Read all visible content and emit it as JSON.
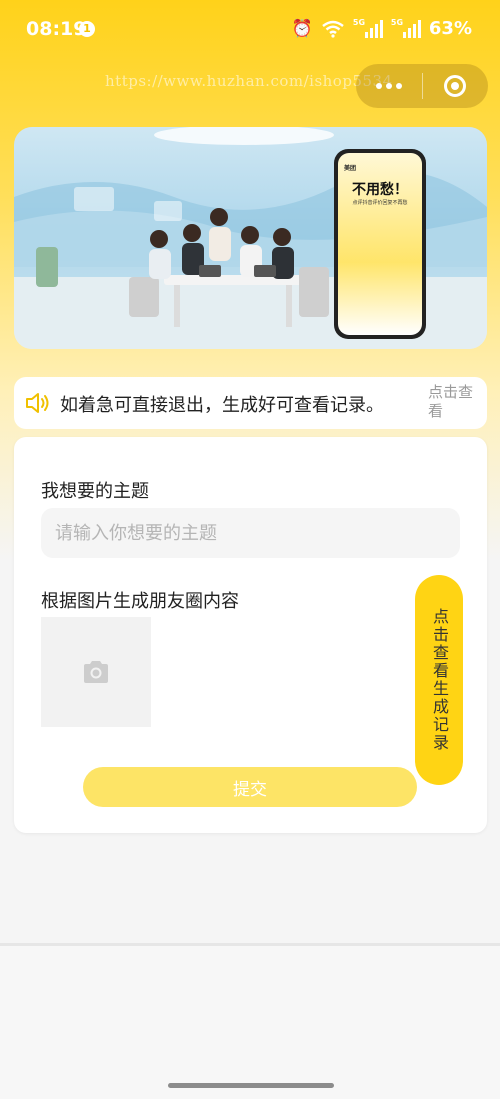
{
  "status_bar": {
    "time": "08:19",
    "notification_count": "1",
    "battery": "63%",
    "network_tag_1": "5G",
    "network_tag_2": "5G"
  },
  "watermark": "https://www.huzhan.com/ishop5534",
  "banner": {
    "phone_brand": "美团",
    "phone_title": "不用愁！",
    "phone_subtitle": "点评抖音评价回复不再愁"
  },
  "notice": {
    "text": "如着急可直接退出，生成好可查看记录。",
    "link": "点击查看"
  },
  "form": {
    "topic_label": "我想要的主题",
    "topic_placeholder": "请输入你想要的主题",
    "image_label": "根据图片生成朋友圈内容",
    "submit": "提交"
  },
  "float_button": "点击查看生成记录",
  "colors": {
    "accent": "#ffd414",
    "submit_bg": "#fde466",
    "placeholder": "#b5b5b5"
  }
}
